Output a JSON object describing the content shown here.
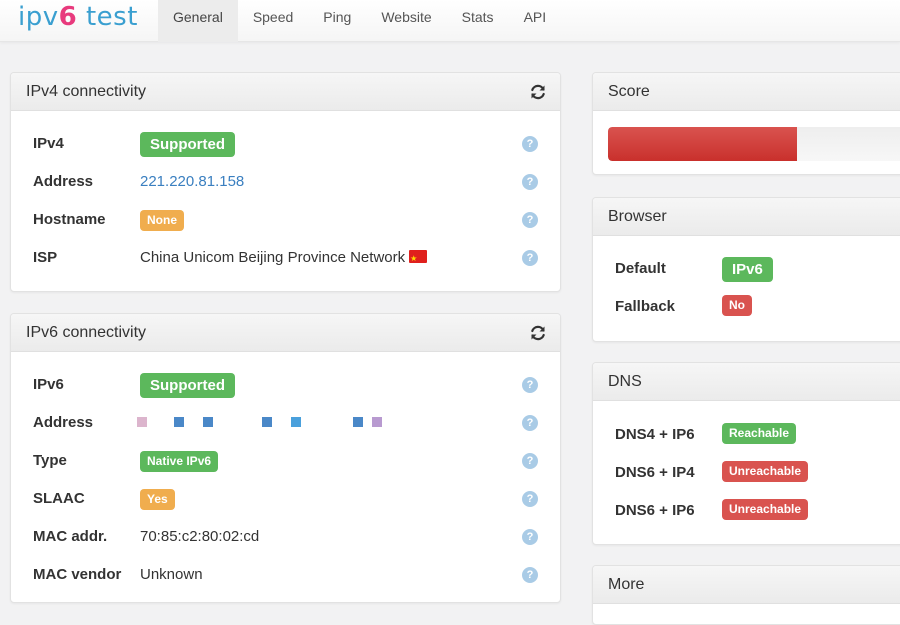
{
  "brand": {
    "prefix": "ipv",
    "six": "6",
    "suffix": " test"
  },
  "nav": [
    {
      "label": "General",
      "active": true
    },
    {
      "label": "Speed"
    },
    {
      "label": "Ping"
    },
    {
      "label": "Website"
    },
    {
      "label": "Stats"
    },
    {
      "label": "API"
    }
  ],
  "ipv4": {
    "title": "IPv4 connectivity",
    "refresh_icon": "refresh-icon",
    "rows": [
      {
        "label": "IPv4",
        "value": "Supported",
        "kind": "badge",
        "color": "#5cb85c"
      },
      {
        "label": "Address",
        "value": "221.220.81.158",
        "kind": "link"
      },
      {
        "label": "Hostname",
        "value": "None",
        "kind": "badge-sm",
        "color": "#f0ad4e"
      },
      {
        "label": "ISP",
        "value": "China Unicom Beijing Province Network",
        "kind": "text",
        "flag": "CN"
      }
    ],
    "help_glyph": "?"
  },
  "ipv6": {
    "title": "IPv6 connectivity",
    "refresh_icon": "refresh-icon",
    "rows": [
      {
        "label": "IPv6",
        "value": "Supported",
        "kind": "badge",
        "color": "#5cb85c"
      },
      {
        "label": "Address",
        "value": "",
        "kind": "redacted"
      },
      {
        "label": "Type",
        "value": "Native IPv6",
        "kind": "badge-sm",
        "color": "#5cb85c"
      },
      {
        "label": "SLAAC",
        "value": "Yes",
        "kind": "badge-sm",
        "color": "#f0ad4e"
      },
      {
        "label": "MAC addr.",
        "value": "70:85:c2:80:02:cd",
        "kind": "text"
      },
      {
        "label": "MAC vendor",
        "value": "Unknown",
        "kind": "text"
      }
    ],
    "help_glyph": "?"
  },
  "score": {
    "title": "Score",
    "fill_fraction_of_visible": 0.63,
    "bar_color": "#d9534f"
  },
  "browser": {
    "title": "Browser",
    "rows": [
      {
        "label": "Default",
        "value": "IPv6",
        "kind": "badge",
        "color": "#5cb85c"
      },
      {
        "label": "Fallback",
        "value": "No",
        "kind": "badge-sm",
        "color": "#d9534f"
      }
    ]
  },
  "dns": {
    "title": "DNS",
    "rows": [
      {
        "label": "DNS4 + IP6",
        "value": "Reachable",
        "color": "#5cb85c"
      },
      {
        "label": "DNS6 + IP4",
        "value": "Unreachable",
        "color": "#d9534f"
      },
      {
        "label": "DNS6 + IP6",
        "value": "Unreachable",
        "color": "#d9534f"
      }
    ]
  },
  "more": {
    "title": "More"
  }
}
